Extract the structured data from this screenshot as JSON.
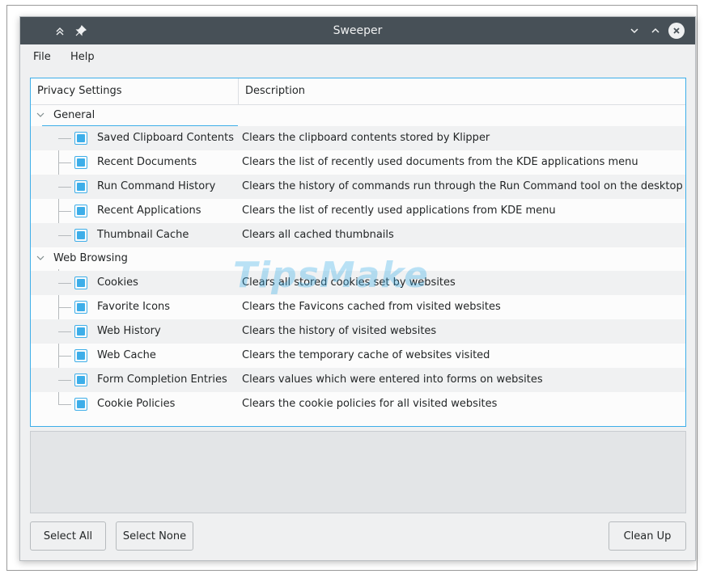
{
  "window": {
    "title": "Sweeper"
  },
  "menu": {
    "file": "File",
    "help": "Help"
  },
  "tree": {
    "headers": {
      "settings": "Privacy Settings",
      "description": "Description"
    },
    "groups": [
      {
        "label": "General",
        "items": [
          {
            "label": "Saved Clipboard Contents",
            "description": "Clears the clipboard contents stored by Klipper"
          },
          {
            "label": "Recent Documents",
            "description": "Clears the list of recently used documents from the KDE applications menu"
          },
          {
            "label": "Run Command History",
            "description": "Clears the history of commands run through the Run Command tool on the desktop"
          },
          {
            "label": "Recent Applications",
            "description": "Clears the list of recently used applications from KDE menu"
          },
          {
            "label": "Thumbnail Cache",
            "description": "Clears all cached thumbnails"
          }
        ]
      },
      {
        "label": "Web Browsing",
        "items": [
          {
            "label": "Cookies",
            "description": "Clears all stored cookies set by websites"
          },
          {
            "label": "Favorite Icons",
            "description": "Clears the Favicons cached from visited websites"
          },
          {
            "label": "Web History",
            "description": "Clears the history of visited websites"
          },
          {
            "label": "Web Cache",
            "description": "Clears the temporary cache of websites visited"
          },
          {
            "label": "Form Completion Entries",
            "description": "Clears values which were entered into forms on websites"
          },
          {
            "label": "Cookie Policies",
            "description": "Clears the cookie policies for all visited websites"
          }
        ]
      }
    ]
  },
  "watermark": "TipsMake",
  "buttons": {
    "select_all": "Select All",
    "select_none": "Select None",
    "clean_up": "Clean Up"
  },
  "colors": {
    "titlebar": "#475057",
    "accent": "#3daee9",
    "window_bg": "#eff0f1"
  }
}
